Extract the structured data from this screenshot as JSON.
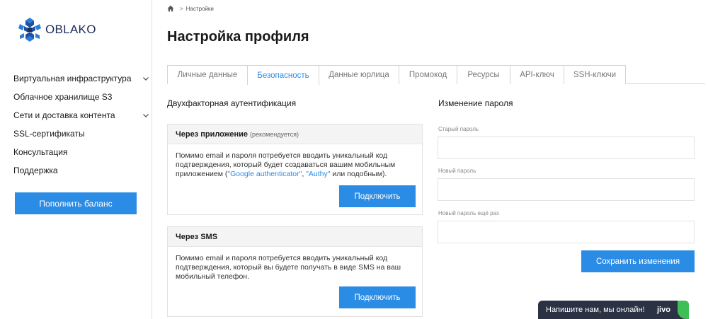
{
  "brand": {
    "name": "OBLAKO",
    "logo_icon": "cube-cluster-logo-icon",
    "color": "#2b7ed8"
  },
  "sidebar": {
    "items": [
      {
        "label": "Виртуальная инфраструктура",
        "has_chevron": true
      },
      {
        "label": "Облачное хранилище S3",
        "has_chevron": false
      },
      {
        "label": "Сети и доставка контента",
        "has_chevron": true
      },
      {
        "label": "SSL-сертификаты",
        "has_chevron": false
      },
      {
        "label": "Консультация",
        "has_chevron": false
      },
      {
        "label": "Поддержка",
        "has_chevron": false
      }
    ],
    "balance_button": "Пополнить баланс"
  },
  "breadcrumb": {
    "home_icon": "home-icon",
    "separator": ">",
    "current": "Настройки"
  },
  "page_title": "Настройка профиля",
  "tabs": [
    {
      "label": "Личные данные",
      "active": false
    },
    {
      "label": "Безопасность",
      "active": true
    },
    {
      "label": "Данные юрлица",
      "active": false
    },
    {
      "label": "Промокод",
      "active": false
    },
    {
      "label": "Ресурсы",
      "active": false
    },
    {
      "label": "API-ключ",
      "active": false
    },
    {
      "label": "SSH-ключи",
      "active": false
    }
  ],
  "two_factor": {
    "title": "Двухфакторная аутентификация",
    "app": {
      "heading": "Через приложение",
      "hint": "(рекомендуется)",
      "text_before": "Помимо email и пароля потребуется вводить уникальный код подтверждения, который будет создаваться вашим мобильным приложением (",
      "link1": "\"Google authenticator\"",
      "text_between": ", ",
      "link2": "\"Authy\"",
      "text_after": " или подобным).",
      "button": "Подключить"
    },
    "sms": {
      "heading": "Через SMS",
      "text": "Помимо email и пароля потребуется вводить уникальный код подтверждения, который вы будете получать в виде SMS на ваш мобильный телефон.",
      "button": "Подключить"
    }
  },
  "password": {
    "title": "Изменение пароля",
    "old_label": "Старый пароль",
    "new_label": "Новый пароль",
    "repeat_label": "Новый пароль ещё раз",
    "old_value": "",
    "new_value": "",
    "repeat_value": "",
    "save_button": "Сохранить изменения"
  },
  "chat_widget": {
    "text": "Напишите нам, мы онлайн!",
    "logo": "jivo"
  },
  "colors": {
    "accent": "#2b8ce6",
    "chat_bg": "#2a3244",
    "chat_status": "#3fbf55"
  }
}
